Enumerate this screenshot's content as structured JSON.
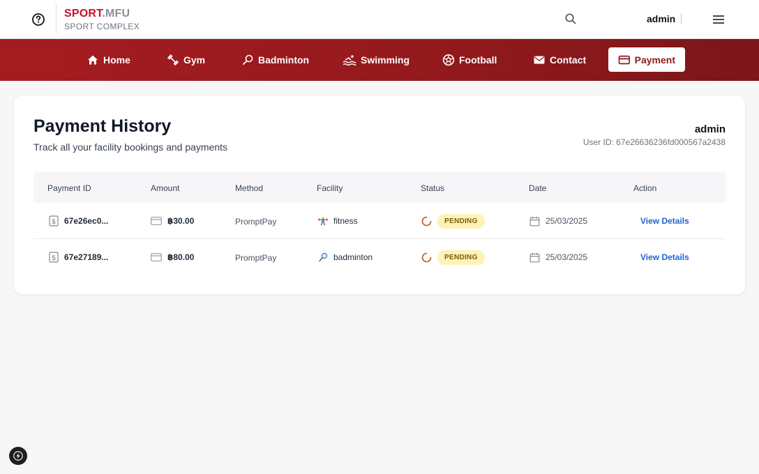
{
  "header": {
    "brand_primary": "SPORT",
    "brand_secondary": ".MFU",
    "brand_sub": "SPORT COMPLEX",
    "username": "admin",
    "icons": {
      "help": "help-circle-icon",
      "search": "search-icon",
      "menu": "hamburger-menu-icon"
    }
  },
  "nav": {
    "items": [
      {
        "label": "Home",
        "icon": "home-icon"
      },
      {
        "label": "Gym",
        "icon": "dumbbell-icon"
      },
      {
        "label": "Badminton",
        "icon": "badminton-racket-icon"
      },
      {
        "label": "Swimming",
        "icon": "swimming-icon"
      },
      {
        "label": "Football",
        "icon": "football-icon"
      },
      {
        "label": "Contact",
        "icon": "mail-icon"
      },
      {
        "label": "Payment",
        "icon": "credit-card-icon",
        "active": true
      }
    ]
  },
  "page": {
    "title": "Payment History",
    "subtitle": "Track all your facility bookings and payments",
    "user_name": "admin",
    "user_id": "User ID: 67e26636236fd000567a2438"
  },
  "table": {
    "headers": [
      "Payment ID",
      "Amount",
      "Method",
      "Facility",
      "Status",
      "Date",
      "Action"
    ],
    "rows": [
      {
        "payment_id": "67e26ec0...",
        "amount": "฿30.00",
        "method": "PromptPay",
        "facility": "fitness",
        "facility_icon": "weightlifter-icon",
        "status": "PENDING",
        "date": "25/03/2025",
        "action": "View Details"
      },
      {
        "payment_id": "67e27189...",
        "amount": "฿80.00",
        "method": "PromptPay",
        "facility": "badminton",
        "facility_icon": "badminton-racket-icon",
        "status": "PENDING",
        "date": "25/03/2025",
        "action": "View Details"
      }
    ]
  },
  "colors": {
    "brand_red": "#c8102e",
    "nav_bg": "#a51c20",
    "link_blue": "#1d64d8",
    "pending_bg": "#fdf3b7"
  }
}
